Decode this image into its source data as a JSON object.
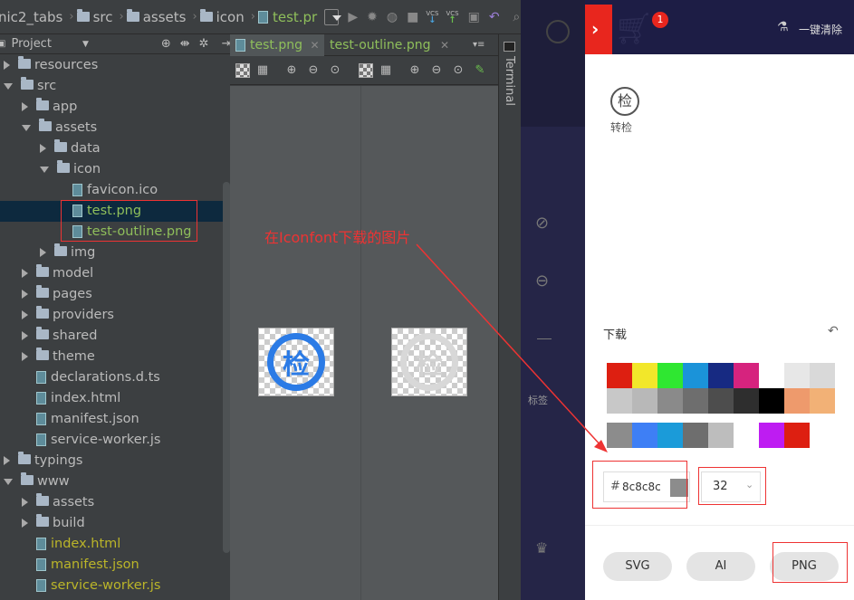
{
  "nav": {
    "project_name": "nic2_tabs",
    "crumbs": [
      "src",
      "assets",
      "icon",
      "test.pr"
    ],
    "vcs_label": "VCS"
  },
  "project_header": {
    "label": "Project"
  },
  "tree": [
    {
      "label": "resources",
      "level": 1,
      "type": "folder",
      "state": "closed"
    },
    {
      "label": "src",
      "level": 1,
      "type": "folder",
      "state": "open"
    },
    {
      "label": "app",
      "level": 2,
      "type": "folder",
      "state": "closed"
    },
    {
      "label": "assets",
      "level": 2,
      "type": "folder",
      "state": "open"
    },
    {
      "label": "data",
      "level": 3,
      "type": "folder",
      "state": "closed"
    },
    {
      "label": "icon",
      "level": 3,
      "type": "folder",
      "state": "open"
    },
    {
      "label": "favicon.ico",
      "level": 4,
      "type": "file",
      "color": "normal"
    },
    {
      "label": "test.png",
      "level": 4,
      "type": "file",
      "color": "green",
      "selected": true
    },
    {
      "label": "test-outline.png",
      "level": 4,
      "type": "file",
      "color": "green"
    },
    {
      "label": "img",
      "level": 3,
      "type": "folder",
      "state": "closed"
    },
    {
      "label": "model",
      "level": 2,
      "type": "folder",
      "state": "closed"
    },
    {
      "label": "pages",
      "level": 2,
      "type": "folder",
      "state": "closed"
    },
    {
      "label": "providers",
      "level": 2,
      "type": "folder",
      "state": "closed"
    },
    {
      "label": "shared",
      "level": 2,
      "type": "folder",
      "state": "closed"
    },
    {
      "label": "theme",
      "level": 2,
      "type": "folder",
      "state": "closed"
    },
    {
      "label": "declarations.d.ts",
      "level": 2,
      "type": "file",
      "color": "normal"
    },
    {
      "label": "index.html",
      "level": 2,
      "type": "file",
      "color": "normal"
    },
    {
      "label": "manifest.json",
      "level": 2,
      "type": "file",
      "color": "normal"
    },
    {
      "label": "service-worker.js",
      "level": 2,
      "type": "file",
      "color": "normal"
    },
    {
      "label": "typings",
      "level": 1,
      "type": "folder",
      "state": "closed"
    },
    {
      "label": "www",
      "level": 1,
      "type": "folder",
      "state": "open"
    },
    {
      "label": "assets",
      "level": 2,
      "type": "folder",
      "state": "closed"
    },
    {
      "label": "build",
      "level": 2,
      "type": "folder",
      "state": "closed"
    },
    {
      "label": "index.html",
      "level": 2,
      "type": "file",
      "color": "yellow"
    },
    {
      "label": "manifest.json",
      "level": 2,
      "type": "file",
      "color": "yellow"
    },
    {
      "label": "service-worker.js",
      "level": 2,
      "type": "file",
      "color": "yellow"
    }
  ],
  "editor_tabs": [
    {
      "label": "test.png",
      "active": true
    },
    {
      "label": "test-outline.png",
      "active": false
    }
  ],
  "glyph": "检",
  "terminal_label": "Terminal",
  "annotation": "在Iconfont下载的图片",
  "iconfont": {
    "cart_badge": "1",
    "clear_label": "一键清除",
    "item_label": "转检",
    "download_title": "下载",
    "hex_prefix": "#",
    "hex_value": "8c8c8c",
    "size_value": "32",
    "buttons": [
      "SVG",
      "AI",
      "PNG"
    ],
    "side_label": "标签",
    "colors_row1": [
      "#dd1f11",
      "#f2e72a",
      "#2fe731",
      "#1b93d9",
      "#172a82",
      "#d6237e",
      "#ffffff",
      "#e7e7e7",
      "#d9d9d9"
    ],
    "colors_row2": [
      "#c8c8c8",
      "#b8b8b8",
      "#8a8a8a",
      "#6e6e6e",
      "#4d4d4d",
      "#2e2e2e",
      "#000000",
      "#ee9a6c",
      "#f2b176"
    ],
    "colors_row3": [
      "#8c8c8c",
      "#3e7ff5",
      "#1b9bd9",
      "#6e6e6e",
      "#bdbdbd",
      "#ffffff",
      "#be1cf2",
      "#dd1f11"
    ],
    "selected_color": "#8c8c8c"
  }
}
